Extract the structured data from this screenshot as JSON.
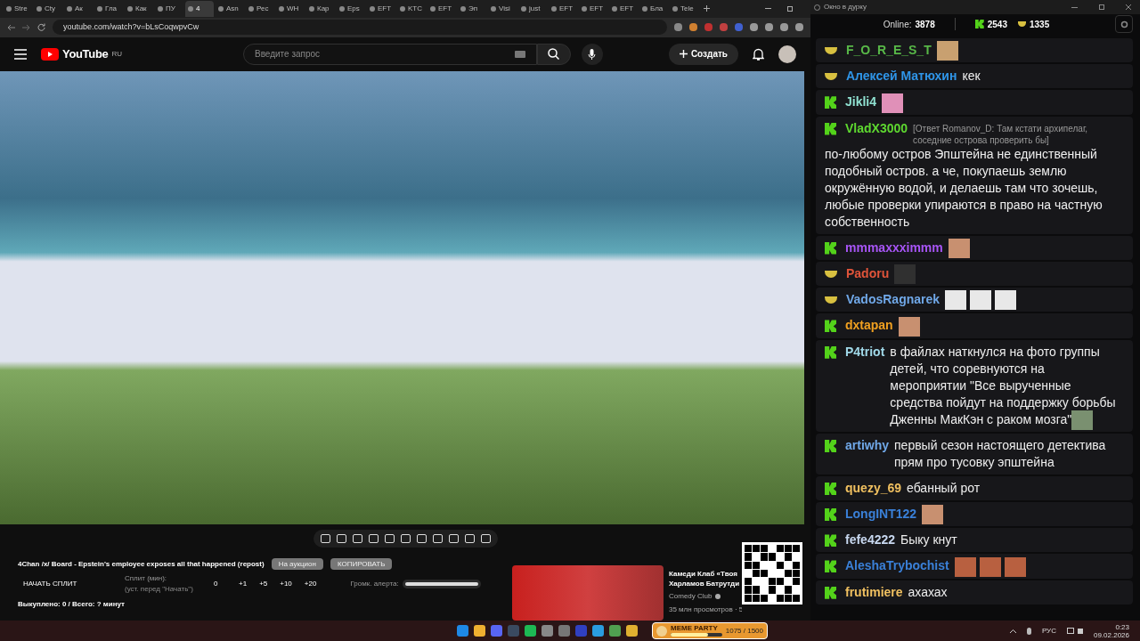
{
  "browser": {
    "tabs": [
      {
        "title": "Stre",
        "selected": false
      },
      {
        "title": "Cty",
        "selected": false
      },
      {
        "title": "Ак",
        "selected": false
      },
      {
        "title": "Гла",
        "selected": false
      },
      {
        "title": "Как",
        "selected": false
      },
      {
        "title": "ПУ",
        "selected": false
      },
      {
        "title": "4",
        "selected": true
      },
      {
        "title": "Asn",
        "selected": false
      },
      {
        "title": "Рес",
        "selected": false
      },
      {
        "title": "WH",
        "selected": false
      },
      {
        "title": "Кар",
        "selected": false
      },
      {
        "title": "Eps",
        "selected": false
      },
      {
        "title": "EFT",
        "selected": false
      },
      {
        "title": "KTC",
        "selected": false
      },
      {
        "title": "EFT",
        "selected": false
      },
      {
        "title": "Эп",
        "selected": false
      },
      {
        "title": "Visi",
        "selected": false
      },
      {
        "title": "just",
        "selected": false
      },
      {
        "title": "EFT",
        "selected": false
      },
      {
        "title": "EFT",
        "selected": false
      },
      {
        "title": "EFT",
        "selected": false
      },
      {
        "title": "Бла",
        "selected": false
      },
      {
        "title": "Tele",
        "selected": false
      }
    ],
    "address": "youtube.com/watch?v=bLsCoqwpvCw"
  },
  "youtube": {
    "logo": "YouTube",
    "region": "RU",
    "search": {
      "placeholder": "Введите запрос"
    },
    "create_button": "Создать"
  },
  "stream_panel": {
    "title": "4Chan /x/ Board - Epstein's employee exposes all that happened (repost)",
    "buttons": [
      "На аукцион",
      "КОПИРОВАТЬ"
    ],
    "start_split": "НАЧАТЬ СПЛИТ",
    "split_label": "Сплит (мин):",
    "split_hint": "(уст. перед \"Начать\")",
    "split_value": "0",
    "increments": [
      "+1",
      "+5",
      "+10",
      "+20"
    ],
    "alert_label": "Громк. алерта:",
    "alert_volume": {
      "level": 1
    },
    "summary": "Выкуплено: 0 / Всего: ? минут"
  },
  "recommendation": {
    "title_lines": [
      "Камеди Клаб «Твоя",
      "Харламов Батрутди"
    ],
    "channel": "Comedy Club",
    "meta": "35 млн просмотров · 5"
  },
  "chat_window": {
    "title": "Окно в дурку",
    "online_label": "Online:",
    "online": "3878",
    "kick_count": "2543",
    "bowl_count": "1335",
    "messages": [
      {
        "user": "F_O_R_E_S_T",
        "kind": "bowl",
        "color": "#58b848",
        "emotes": [
          {
            "color": "#c8a070"
          }
        ]
      },
      {
        "user": "Алексей Матюхин",
        "kind": "bowl",
        "color": "#2f95e8",
        "text": "кек"
      },
      {
        "user": "Jikli4",
        "kind": "kick",
        "color": "#8fe0d0",
        "emotes": [
          {
            "color": "#e090b8"
          }
        ]
      },
      {
        "user": "VladX3000",
        "kind": "kick",
        "color": "#5ed830",
        "reply": "[Ответ Romanov_D: Там кстати архипелаг, соседние острова проверить бы]",
        "text": "по-любому остров Эпштейна не единственный подобный остров. а че, покупаешь землю окружённую водой, и делаешь там что зочешь, любые проверки упираются в право на частную собственность"
      },
      {
        "user": "mmmaxxximmm",
        "kind": "kick",
        "color": "#a855f7",
        "emotes": [
          {
            "color": "#c89070"
          }
        ]
      },
      {
        "user": "Padoru",
        "kind": "bowl",
        "color": "#e0543a",
        "emotes": [
          {
            "color": "#303030"
          }
        ]
      },
      {
        "user": "VadosRagnarek",
        "kind": "bowl",
        "color": "#70a8e8",
        "emotes": [
          {
            "color": "#e8e8e8"
          },
          {
            "color": "#e8e8e8"
          },
          {
            "color": "#e8e8e8"
          }
        ]
      },
      {
        "user": "dxtapan",
        "kind": "kick",
        "color": "#f0a020",
        "emotes": [
          {
            "color": "#c89070"
          }
        ]
      },
      {
        "user": "P4triot",
        "kind": "kick",
        "color": "#a0d8e8",
        "text": "в файлах наткнулся на фото группы детей, что соревнуются на мероприятии \"Все вырученные средства пойдут на поддержку борьбы Дженны МакКэн с раком мозга\"",
        "emotes": [
          {
            "color": "#7a9070"
          }
        ]
      },
      {
        "user": "artiwhy",
        "kind": "kick",
        "color": "#70a8e8",
        "text": "первый сезон настоящего детектива прям про тусовку эпштейна"
      },
      {
        "user": "quezy_69",
        "kind": "kick",
        "color": "#f0c060",
        "text": "ебанный рот"
      },
      {
        "user": "LongINT122",
        "kind": "kick",
        "color": "#3a80d8",
        "emotes": [
          {
            "color": "#c89070"
          }
        ]
      },
      {
        "user": "fefe4222",
        "kind": "kick",
        "color": "#c8d8f0",
        "text": "Быку кнут"
      },
      {
        "user": "AleshaTrybochist",
        "kind": "kick",
        "color": "#3a80d8",
        "emotes": [
          {
            "color": "#b86040"
          },
          {
            "color": "#b86040"
          },
          {
            "color": "#b86040"
          }
        ]
      },
      {
        "user": "frutimiere",
        "kind": "kick",
        "color": "#f0c060",
        "text": "ахахах"
      }
    ]
  },
  "taskbar": {
    "widget": {
      "label": "MEME PARTY",
      "progress": "1075 / 1500",
      "level": 0.72
    },
    "language": "РУС",
    "time": "0:23",
    "date": "09.02.2026"
  }
}
